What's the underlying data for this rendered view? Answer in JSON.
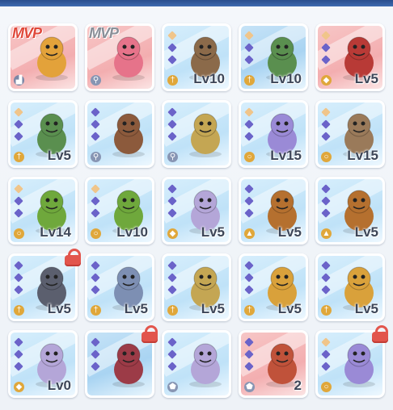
{
  "colors": {
    "star_filled": "#6b63c9",
    "star_gold": "#f0c58a",
    "lock": "#e2554c",
    "level_text": "#3d4658",
    "mvp_red": "#e0483a",
    "mvp_grey": "#8b8f98"
  },
  "cards": [
    {
      "badge": "MVP",
      "badge_color": "red",
      "level": "",
      "bg": "pink",
      "monster": "golden-cat-girl-icon",
      "type_icon": "boot-icon"
    },
    {
      "badge": "MVP",
      "badge_color": "grey",
      "level": "",
      "bg": "pink",
      "monster": "pink-grinning-beast-icon",
      "type_icon": "pin-icon"
    },
    {
      "badge": "",
      "level": "Lv10",
      "bg": "sky",
      "monster": "scarecrow-icon",
      "type_icon": "sword-icon"
    },
    {
      "badge": "",
      "level": "Lv10",
      "bg": "blue",
      "monster": "bug-creature-icon",
      "type_icon": "sword-icon"
    },
    {
      "badge": "",
      "level": "Lv5",
      "bg": "pink",
      "monster": "skull-mask-cloak-icon",
      "type_icon": "shield-icon"
    },
    {
      "badge": "",
      "level": "Lv5",
      "bg": "sky",
      "monster": "bug-creature-icon",
      "type_icon": "sword-icon"
    },
    {
      "badge": "",
      "level": "",
      "bg": "sky",
      "monster": "orc-warrior-icon",
      "type_icon": "pin-icon"
    },
    {
      "badge": "",
      "level": "",
      "bg": "sky",
      "monster": "stitched-mask-icon",
      "type_icon": "pin-icon"
    },
    {
      "badge": "",
      "level": "Lv15",
      "bg": "sky",
      "monster": "wolf-beast-icon",
      "type_icon": "ring-icon"
    },
    {
      "badge": "",
      "level": "Lv15",
      "bg": "sky",
      "monster": "totem-pole-icon",
      "type_icon": "ring-icon"
    },
    {
      "badge": "",
      "level": "Lv14",
      "bg": "sky",
      "monster": "mantis-icon",
      "type_icon": "ring-icon"
    },
    {
      "badge": "",
      "level": "Lv10",
      "bg": "sky",
      "monster": "mantis-icon",
      "type_icon": "ring-icon"
    },
    {
      "badge": "",
      "level": "Lv5",
      "bg": "sky",
      "monster": "purple-rat-icon",
      "type_icon": "shield-icon"
    },
    {
      "badge": "",
      "level": "Lv5",
      "bg": "sky",
      "monster": "ram-horn-goat-icon",
      "type_icon": "hat-icon"
    },
    {
      "badge": "",
      "level": "Lv5",
      "bg": "sky",
      "monster": "ram-horn-goat-icon",
      "type_icon": "hat-icon"
    },
    {
      "badge": "",
      "level": "Lv5",
      "bg": "sky",
      "monster": "skeleton-viking-icon",
      "type_icon": "sword-icon",
      "lock": true
    },
    {
      "badge": "",
      "level": "Lv5",
      "bg": "sky",
      "monster": "old-wizard-icon",
      "type_icon": "sword-icon"
    },
    {
      "badge": "",
      "level": "Lv5",
      "bg": "sky",
      "monster": "stitched-mask-icon",
      "type_icon": "sword-icon"
    },
    {
      "badge": "",
      "level": "Lv5",
      "bg": "sky",
      "monster": "scorpion-icon",
      "type_icon": "sword-icon"
    },
    {
      "badge": "",
      "level": "Lv5",
      "bg": "sky",
      "monster": "scorpion-icon",
      "type_icon": "sword-icon"
    },
    {
      "badge": "",
      "level": "Lv0",
      "bg": "sky",
      "monster": "purple-rat-icon",
      "type_icon": "shield-icon"
    },
    {
      "badge": "",
      "level": "",
      "bg": "blue",
      "monster": "winged-bug-icon",
      "type_icon": "",
      "lock": true
    },
    {
      "badge": "",
      "level": "",
      "bg": "sky",
      "monster": "purple-rat-icon",
      "type_icon": "armor-icon"
    },
    {
      "badge": "",
      "level": "2",
      "bg": "pink",
      "monster": "tree-monster-icon",
      "type_icon": "armor-icon"
    },
    {
      "badge": "",
      "level": "",
      "bg": "sky",
      "monster": "wolf-beast-icon",
      "type_icon": "ring-icon",
      "lock": true
    }
  ]
}
